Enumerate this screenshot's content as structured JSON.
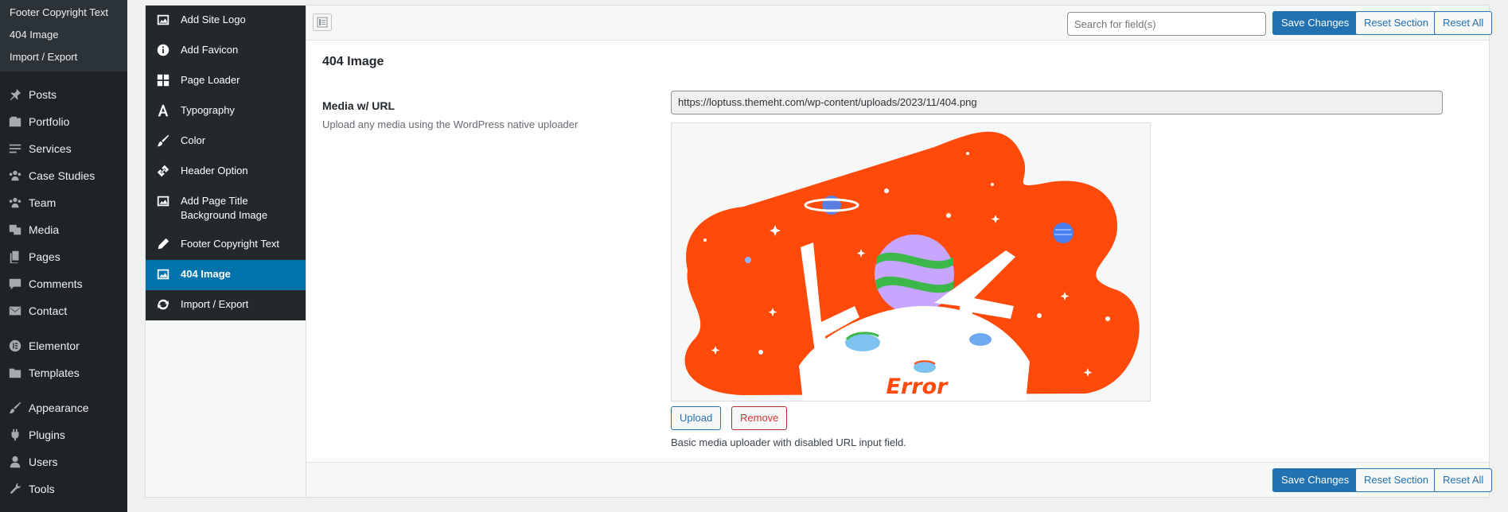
{
  "admin_menu": {
    "submenu": [
      "Footer Copyright Text",
      "404 Image",
      "Import / Export"
    ],
    "items": [
      {
        "label": "Posts",
        "icon": "pin-icon"
      },
      {
        "label": "Portfolio",
        "icon": "portfolio-icon"
      },
      {
        "label": "Services",
        "icon": "list-icon"
      },
      {
        "label": "Case Studies",
        "icon": "groups-icon"
      },
      {
        "label": "Team",
        "icon": "groups-icon"
      },
      {
        "label": "Media",
        "icon": "media-icon"
      },
      {
        "label": "Pages",
        "icon": "pages-icon"
      },
      {
        "label": "Comments",
        "icon": "comment-icon"
      },
      {
        "label": "Contact",
        "icon": "mail-icon"
      },
      {
        "label": "Elementor",
        "icon": "elementor-icon"
      },
      {
        "label": "Templates",
        "icon": "folder-icon"
      },
      {
        "label": "Appearance",
        "icon": "brush-icon"
      },
      {
        "label": "Plugins",
        "icon": "plug-icon"
      },
      {
        "label": "Users",
        "icon": "user-icon"
      },
      {
        "label": "Tools",
        "icon": "wrench-icon"
      }
    ]
  },
  "options_nav": {
    "items": [
      {
        "label": "Add Site Logo",
        "icon": "image-icon"
      },
      {
        "label": "Add Favicon",
        "icon": "info-icon"
      },
      {
        "label": "Page Loader",
        "icon": "grid-icon"
      },
      {
        "label": "Typography",
        "icon": "font-icon"
      },
      {
        "label": "Color",
        "icon": "brush-icon"
      },
      {
        "label": "Header Option",
        "icon": "link-icon"
      },
      {
        "label": "Add Page Title Background Image",
        "icon": "image-icon"
      },
      {
        "label": "Footer Copyright Text",
        "icon": "pencil-icon"
      },
      {
        "label": "404 Image",
        "icon": "image-icon",
        "active": true
      },
      {
        "label": "Import / Export",
        "icon": "refresh-icon"
      }
    ]
  },
  "toolbar": {
    "search_placeholder": "Search for field(s)",
    "save_label": "Save Changes",
    "reset_section_label": "Reset Section",
    "reset_all_label": "Reset All"
  },
  "section": {
    "title": "404 Image",
    "field_label": "Media w/ URL",
    "field_description": "Upload any media using the WordPress native uploader",
    "url_value": "https://loptuss.themeht.com/wp-content/uploads/2023/11/404.png",
    "preview_text": "Error",
    "upload_label": "Upload",
    "remove_label": "Remove",
    "help_text": "Basic media uploader with disabled URL input field."
  },
  "colors": {
    "accent": "#2271b1",
    "active_nav": "#0073aa",
    "sidebar_bg": "#1d2327",
    "preview_blob": "#ff4a0a"
  }
}
